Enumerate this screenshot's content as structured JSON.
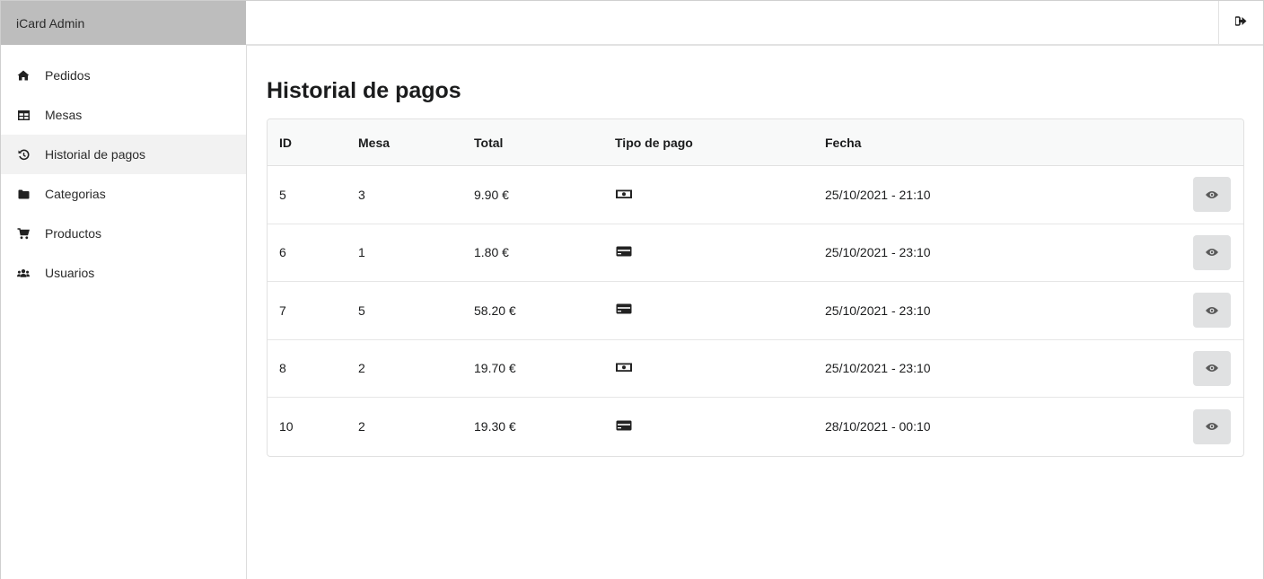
{
  "brand": {
    "title": "iCard Admin"
  },
  "topbar": {
    "logout_icon": "sign-out-icon"
  },
  "sidebar": {
    "items": [
      {
        "label": "Pedidos",
        "icon": "home-icon"
      },
      {
        "label": "Mesas",
        "icon": "table-icon"
      },
      {
        "label": "Historial de pagos",
        "icon": "history-icon",
        "active": true
      },
      {
        "label": "Categorias",
        "icon": "folder-icon"
      },
      {
        "label": "Productos",
        "icon": "cart-icon"
      },
      {
        "label": "Usuarios",
        "icon": "users-icon"
      }
    ]
  },
  "main": {
    "title": "Historial de pagos",
    "columns": [
      "ID",
      "Mesa",
      "Total",
      "Tipo de pago",
      "Fecha"
    ],
    "rows": [
      {
        "id": "5",
        "mesa": "3",
        "total": "9.90 €",
        "tipo": "cash-icon",
        "fecha": "25/10/2021 - 21:10"
      },
      {
        "id": "6",
        "mesa": "1",
        "total": "1.80 €",
        "tipo": "credit-card-icon",
        "fecha": "25/10/2021 - 23:10"
      },
      {
        "id": "7",
        "mesa": "5",
        "total": "58.20 €",
        "tipo": "credit-card-icon",
        "fecha": "25/10/2021 - 23:10"
      },
      {
        "id": "8",
        "mesa": "2",
        "total": "19.70 €",
        "tipo": "cash-icon",
        "fecha": "25/10/2021 - 23:10"
      },
      {
        "id": "10",
        "mesa": "2",
        "total": "19.30 €",
        "tipo": "credit-card-icon",
        "fecha": "28/10/2021 - 00:10"
      }
    ]
  },
  "colors": {
    "brand_bg": "#bdbdbd",
    "active_bg": "#f2f2f2",
    "header_bg": "#f8f9f9",
    "button_bg": "#e0e1e2"
  }
}
